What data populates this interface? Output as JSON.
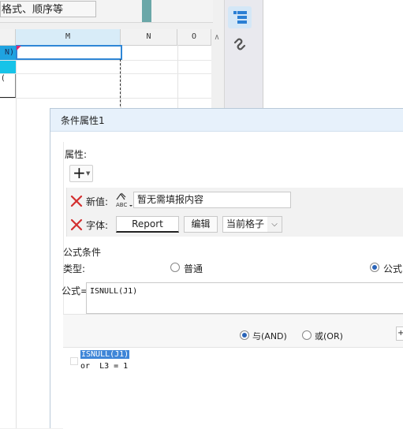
{
  "toolbar": {
    "hint_text": "格式、顺序等"
  },
  "sheet": {
    "columns": [
      "M",
      "N",
      "O"
    ],
    "row_labels": [
      "N)",
      "("
    ]
  },
  "side_panel": {
    "icons": [
      "cell-properties-icon",
      "link-icon"
    ]
  },
  "dialog": {
    "title": "条件属性1",
    "properties_label": "属性:",
    "rows": [
      {
        "label": "新值:",
        "value": "暂无需填报内容"
      },
      {
        "label": "字体:",
        "value": "Report",
        "edit_label": "编辑",
        "scope_value": "当前格子"
      }
    ],
    "formula_section": {
      "title": "公式条件",
      "type_label": "类型:",
      "type_options": [
        {
          "label": "普通",
          "selected": false
        },
        {
          "label": "公式",
          "selected": true
        }
      ],
      "formula_label": "公式=",
      "formula_value": "ISNULL(J1)",
      "logic_options": [
        {
          "label": "与(AND)",
          "selected": true
        },
        {
          "label": "或(OR)",
          "selected": false
        }
      ],
      "conditions": [
        {
          "text": "ISNULL(J1)",
          "selected": true
        },
        {
          "text": "or  L3 = 1",
          "selected": false
        }
      ]
    }
  },
  "colors": {
    "accent": "#2f86d6",
    "dialog_title_bg": "#e7f1fb",
    "delete_red": "#d32f2f",
    "selection": "#3f86d8"
  }
}
